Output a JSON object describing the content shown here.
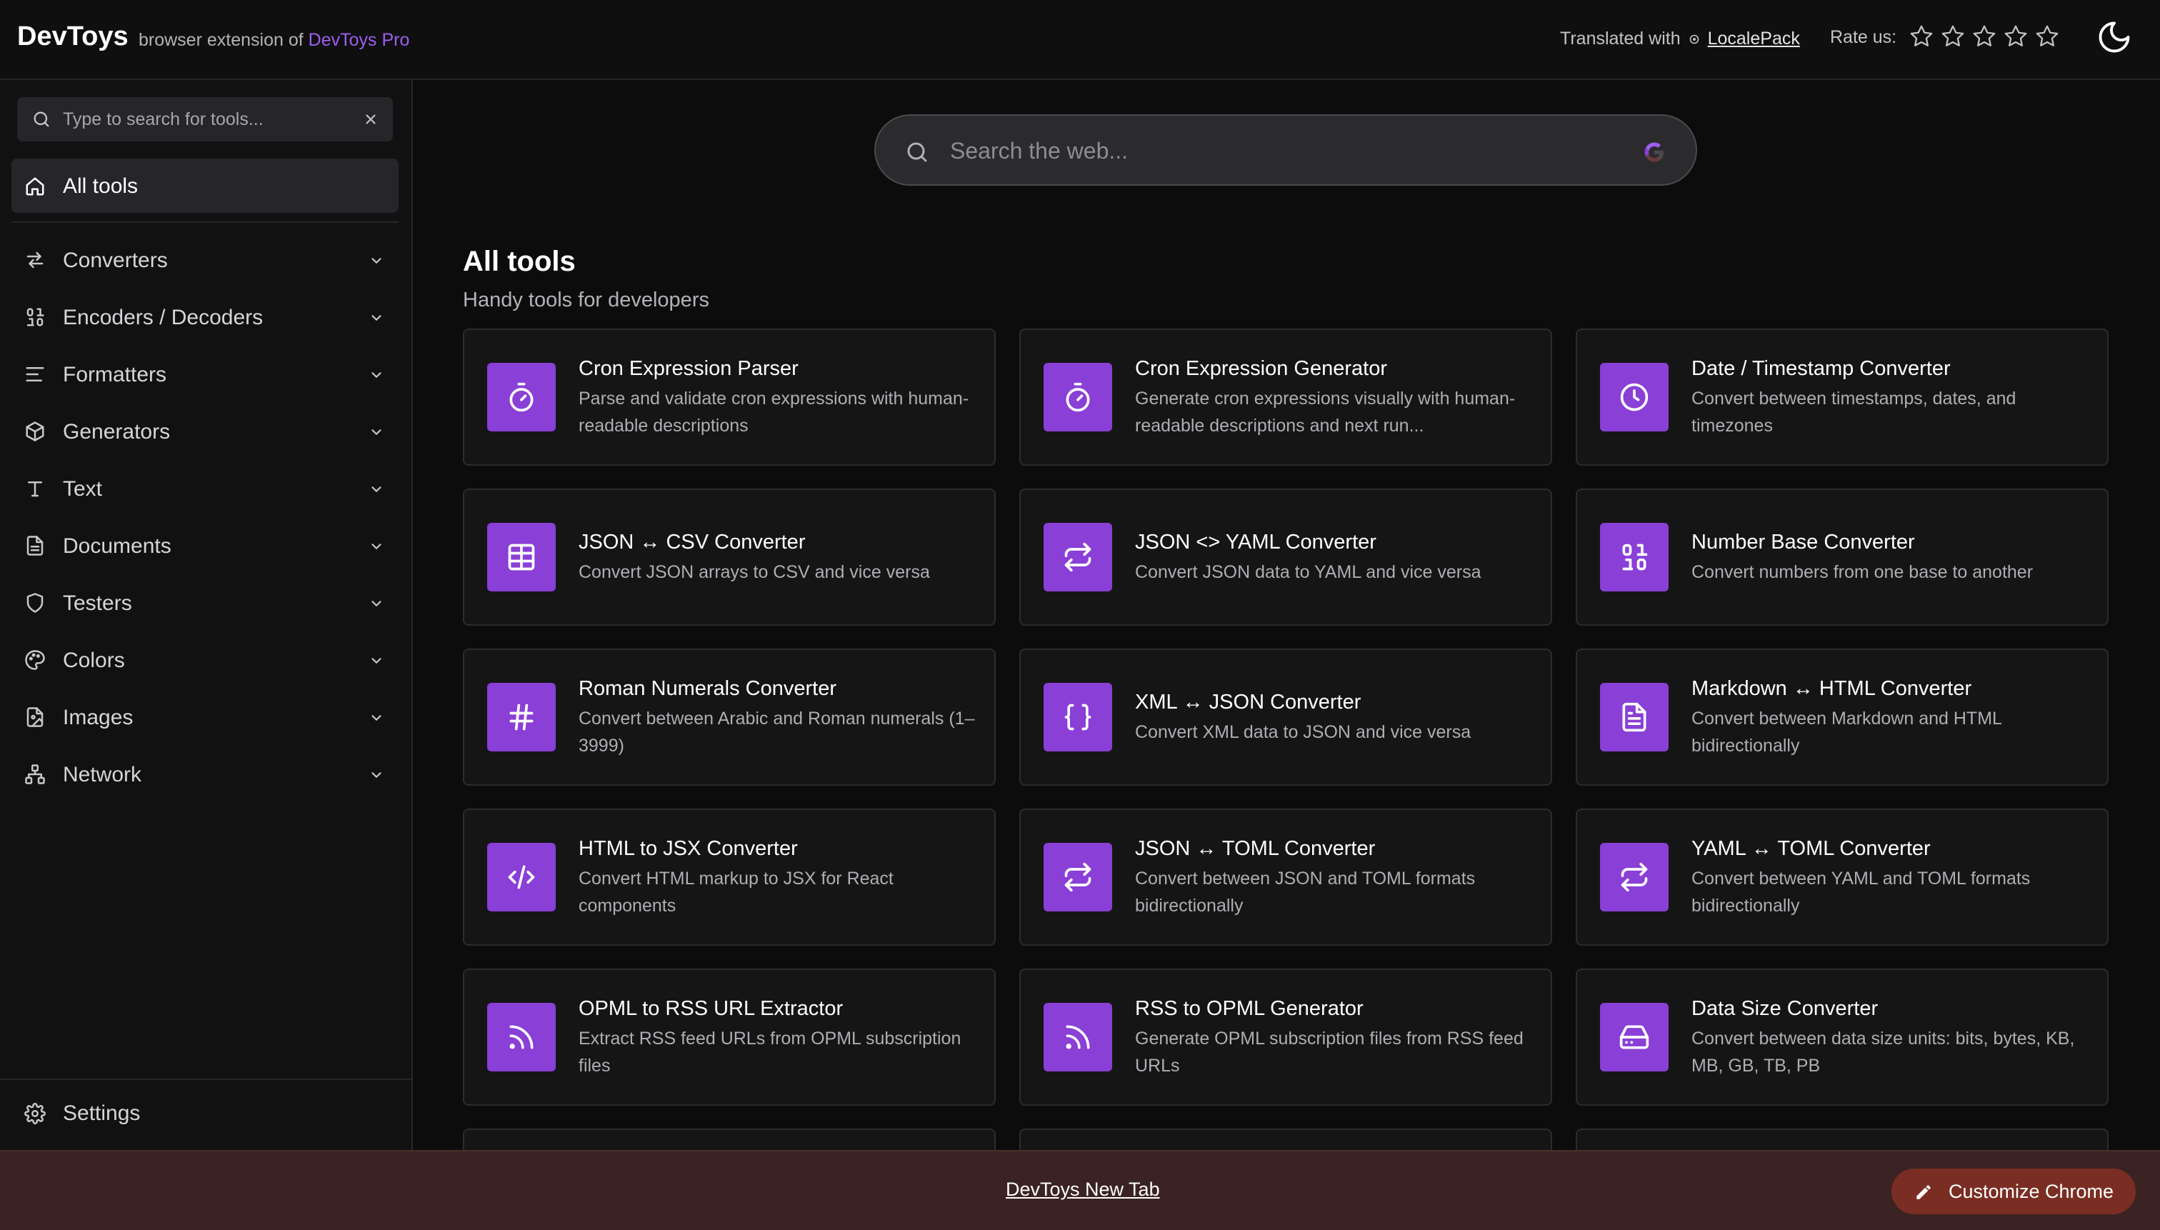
{
  "header": {
    "brand": "DevToys",
    "subtitle_prefix": "browser extension of",
    "subtitle_link": "DevToys Pro",
    "translated_label": "Translated with",
    "translated_link": "LocalePack",
    "rate_label": "Rate us:",
    "rating_stars_filled": 0,
    "rating_stars_total": 5
  },
  "sidebar": {
    "search_placeholder": "Type to search for tools...",
    "all_tools_label": "All tools",
    "items": [
      {
        "label": "Converters",
        "icon": "arrows-swap-icon"
      },
      {
        "label": "Encoders / Decoders",
        "icon": "binary-icon"
      },
      {
        "label": "Formatters",
        "icon": "align-left-icon"
      },
      {
        "label": "Generators",
        "icon": "box-icon"
      },
      {
        "label": "Text",
        "icon": "type-icon"
      },
      {
        "label": "Documents",
        "icon": "document-icon"
      },
      {
        "label": "Testers",
        "icon": "shield-icon"
      },
      {
        "label": "Colors",
        "icon": "palette-icon"
      },
      {
        "label": "Images",
        "icon": "image-file-icon"
      },
      {
        "label": "Network",
        "icon": "network-icon"
      }
    ],
    "settings_label": "Settings"
  },
  "main": {
    "web_search_placeholder": "Search the web...",
    "title": "All tools",
    "subtitle": "Handy tools for developers",
    "tools": [
      {
        "name": "Cron Expression Parser",
        "desc": "Parse and validate cron expressions with human-readable descriptions",
        "icon": "timer-icon"
      },
      {
        "name": "Cron Expression Generator",
        "desc": "Generate cron expressions visually with human-readable descriptions and next run...",
        "icon": "timer-icon"
      },
      {
        "name": "Date / Timestamp Converter",
        "desc": "Convert between timestamps, dates, and timezones",
        "icon": "clock-icon"
      },
      {
        "name": "JSON ↔ CSV Converter",
        "desc": "Convert JSON arrays to CSV and vice versa",
        "icon": "table-icon"
      },
      {
        "name": "JSON <> YAML Converter",
        "desc": "Convert JSON data to YAML and vice versa",
        "icon": "repeat-icon"
      },
      {
        "name": "Number Base Converter",
        "desc": "Convert numbers from one base to another",
        "icon": "binary-icon"
      },
      {
        "name": "Roman Numerals Converter",
        "desc": "Convert between Arabic and Roman numerals (1–3999)",
        "icon": "hash-icon"
      },
      {
        "name": "XML ↔ JSON Converter",
        "desc": "Convert XML data to JSON and vice versa",
        "icon": "braces-icon"
      },
      {
        "name": "Markdown ↔ HTML Converter",
        "desc": "Convert between Markdown and HTML bidirectionally",
        "icon": "file-text-icon"
      },
      {
        "name": "HTML to JSX Converter",
        "desc": "Convert HTML markup to JSX for React components",
        "icon": "code-icon"
      },
      {
        "name": "JSON ↔ TOML Converter",
        "desc": "Convert between JSON and TOML formats bidirectionally",
        "icon": "repeat-icon"
      },
      {
        "name": "YAML ↔ TOML Converter",
        "desc": "Convert between YAML and TOML formats bidirectionally",
        "icon": "repeat-icon"
      },
      {
        "name": "OPML to RSS URL Extractor",
        "desc": "Extract RSS feed URLs from OPML subscription files",
        "icon": "rss-icon"
      },
      {
        "name": "RSS to OPML Generator",
        "desc": "Generate OPML subscription files from RSS feed URLs",
        "icon": "rss-icon"
      },
      {
        "name": "Data Size Converter",
        "desc": "Convert between data size units: bits, bytes, KB, MB, GB, TB, PB",
        "icon": "hard-drive-icon"
      }
    ]
  },
  "footer": {
    "link_label": "DevToys New Tab",
    "customize_label": "Customize Chrome"
  },
  "colors": {
    "accent": "#8a3fd6",
    "brand_link": "#9f5ef0",
    "footer_bg": "#3a2322",
    "customize_button": "#7a2e23"
  }
}
